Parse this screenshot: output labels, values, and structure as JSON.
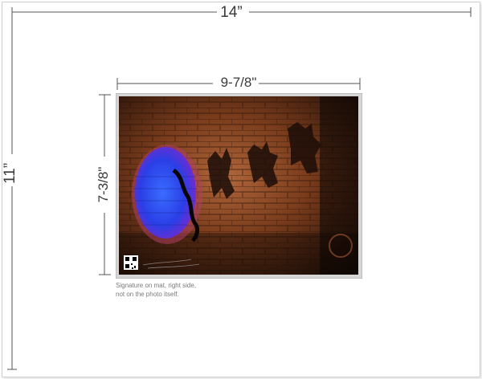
{
  "dimensions": {
    "overall_width": "14”",
    "overall_height": "11”",
    "photo_width": "9-7/8\"",
    "photo_height": "7-3/8\""
  },
  "caption": {
    "line1": "Signature on mat, right side,",
    "line2": "not on the photo itself."
  },
  "colors": {
    "dimension_line": "#555555",
    "portal_glow": "#2f4bff",
    "wall_warm": "#8a4a22"
  }
}
